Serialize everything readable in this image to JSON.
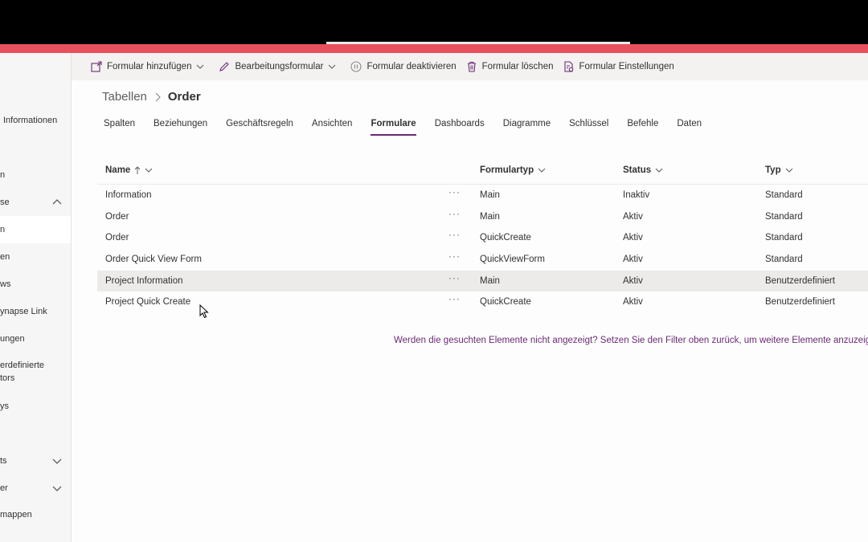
{
  "colors": {
    "accent": "#e8505e",
    "brand": "#6b2b75"
  },
  "leftnav": {
    "items": [
      {
        "label": "Informationen"
      },
      {
        "label": "n"
      },
      {
        "label": "se",
        "chevron": "up"
      },
      {
        "label": "n",
        "active": true
      },
      {
        "label": "en"
      },
      {
        "label": "ws"
      },
      {
        "label": "ynapse Link"
      },
      {
        "label": "ungen"
      },
      {
        "label1": "erdefinierte",
        "label2": "tors"
      },
      {
        "label": "ys"
      },
      {
        "label": "ts",
        "chevron": "down"
      },
      {
        "label": "er",
        "chevron": "down"
      },
      {
        "label": "mappen"
      }
    ]
  },
  "toolbar": {
    "add_form": "Formular hinzufügen",
    "edit_form": "Bearbeitungsformular",
    "deactivate_form": "Formular deaktivieren",
    "delete_form": "Formular löschen",
    "form_settings": "Formular Einstellungen"
  },
  "breadcrumb": {
    "parent": "Tabellen",
    "current": "Order"
  },
  "tabs": [
    "Spalten",
    "Beziehungen",
    "Geschäftsregeln",
    "Ansichten",
    "Formulare",
    "Dashboards",
    "Diagramme",
    "Schlüssel",
    "Befehle",
    "Daten"
  ],
  "active_tab": "Formulare",
  "table": {
    "columns": {
      "name": "Name",
      "formtype": "Formulartyp",
      "status": "Status",
      "type": "Typ"
    },
    "more_label": "···",
    "rows": [
      {
        "name": "Information",
        "formtype": "Main",
        "status": "Inaktiv",
        "type": "Standard"
      },
      {
        "name": "Order",
        "formtype": "Main",
        "status": "Aktiv",
        "type": "Standard"
      },
      {
        "name": "Order",
        "formtype": "QuickCreate",
        "status": "Aktiv",
        "type": "Standard"
      },
      {
        "name": "Order Quick View Form",
        "formtype": "QuickViewForm",
        "status": "Aktiv",
        "type": "Standard"
      },
      {
        "name": "Project Information",
        "formtype": "Main",
        "status": "Aktiv",
        "type": "Benutzerdefiniert",
        "highlighted": true
      },
      {
        "name": "Project Quick Create",
        "formtype": "QuickCreate",
        "status": "Aktiv",
        "type": "Benutzerdefiniert"
      }
    ]
  },
  "notice": "Werden die gesuchten Elemente nicht angezeigt? Setzen Sie den Filter oben zurück, um weitere Elemente anzuzeigen."
}
